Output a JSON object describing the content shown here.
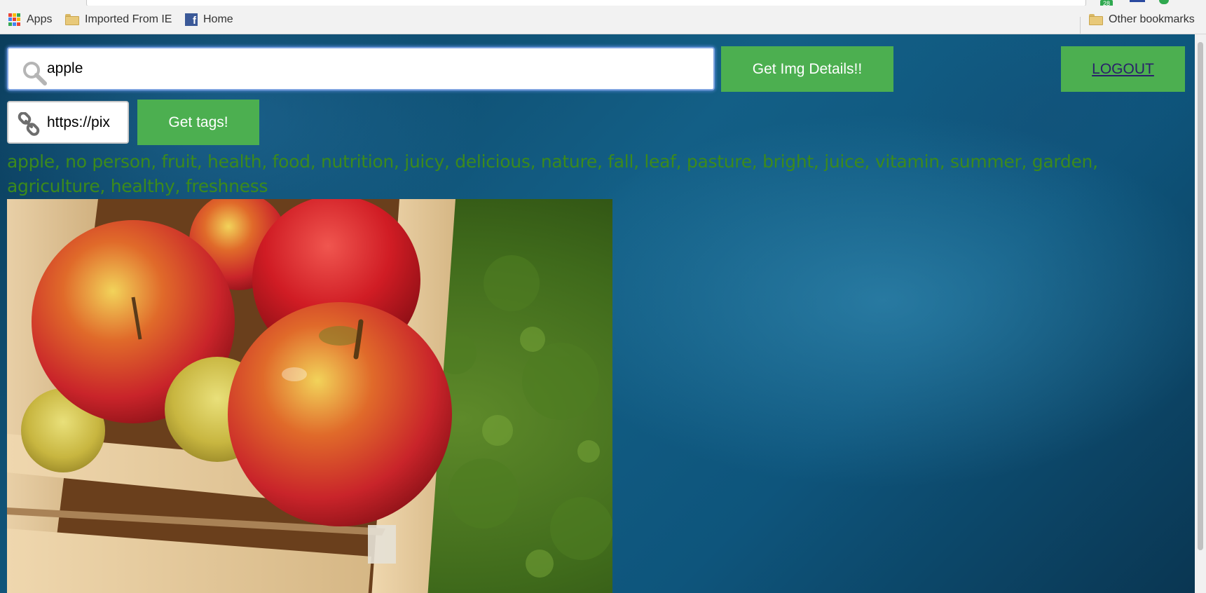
{
  "bookmarks": {
    "apps_label": "Apps",
    "imported_label": "Imported From IE",
    "home_label": "Home",
    "other_label": "Other bookmarks",
    "extension_badge": "28"
  },
  "search": {
    "query_value": "apple",
    "get_details_label": "Get Img Details!!"
  },
  "url": {
    "value": "https://pix",
    "get_tags_label": "Get tags!"
  },
  "logout_label": "LOGOUT",
  "tags_text": "apple, no person, fruit, health, food, nutrition, juicy, delicious, nature, fall, leaf, pasture, bright, juice, vitamin, summer, garden, agriculture, healthy, freshness",
  "colors": {
    "button_green": "#4caf50",
    "tags_green": "#3c8a1c",
    "logout_text": "#2a1f6b"
  },
  "icons": [
    "apps-grid-icon",
    "folder-icon",
    "facebook-icon",
    "magnifier-icon",
    "link-chain-icon"
  ]
}
